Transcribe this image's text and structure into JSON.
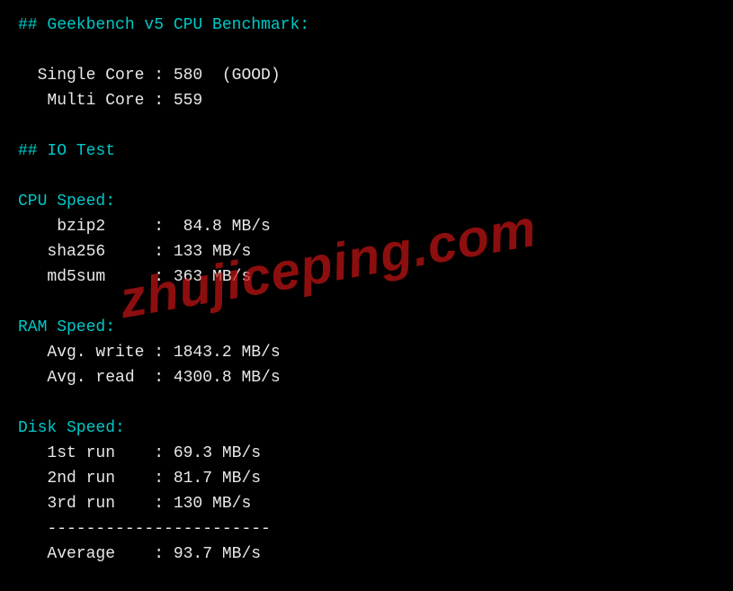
{
  "header_geekbench": "## Geekbench v5 CPU Benchmark:",
  "geekbench": {
    "single_core_label": "  Single Core : ",
    "single_core_value": "580  (GOOD)",
    "multi_core_label": "   Multi Core : ",
    "multi_core_value": "559"
  },
  "header_io": "## IO Test",
  "cpu_speed_header": "CPU Speed:",
  "cpu_speed": {
    "bzip2_label": "    bzip2     :  ",
    "bzip2_value": "84.8 MB/s",
    "sha256_label": "   sha256     : ",
    "sha256_value": "133 MB/s",
    "md5sum_label": "   md5sum     : ",
    "md5sum_value": "363 MB/s"
  },
  "ram_speed_header": "RAM Speed:",
  "ram_speed": {
    "write_label": "   Avg. write : ",
    "write_value": "1843.2 MB/s",
    "read_label": "   Avg. read  : ",
    "read_value": "4300.8 MB/s"
  },
  "disk_speed_header": "Disk Speed:",
  "disk_speed": {
    "run1_label": "   1st run    : ",
    "run1_value": "69.3 MB/s",
    "run2_label": "   2nd run    : ",
    "run2_value": "81.7 MB/s",
    "run3_label": "   3rd run    : ",
    "run3_value": "130 MB/s",
    "divider": "   -----------------------",
    "avg_label": "   Average    : ",
    "avg_value": "93.7 MB/s"
  },
  "watermark_text": "zhujiceping.com"
}
